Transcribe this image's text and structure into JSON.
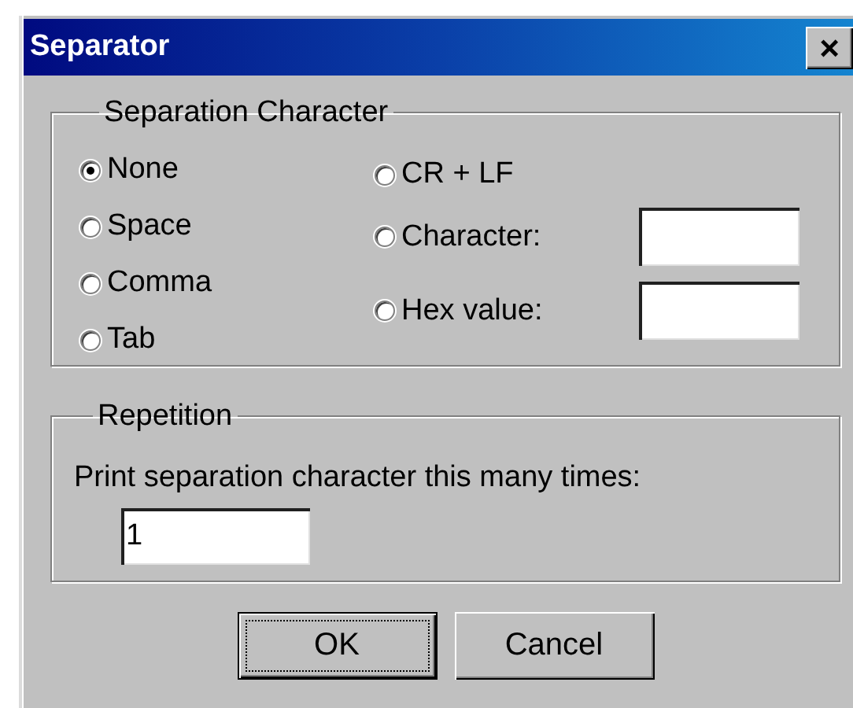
{
  "window": {
    "title": "Separator",
    "close_button": "×"
  },
  "separation_group": {
    "legend": "Separation Character",
    "columns": [
      [
        {
          "label": "None",
          "selected": true,
          "kind": "plain"
        },
        {
          "label": "Space",
          "selected": false,
          "kind": "plain"
        },
        {
          "label": "Comma",
          "selected": false,
          "kind": "plain"
        },
        {
          "label": "Tab",
          "selected": false,
          "kind": "plain"
        }
      ],
      [
        {
          "label": "CR + LF",
          "selected": false,
          "kind": "plain"
        },
        {
          "label": "Character:",
          "selected": false,
          "kind": "with_field"
        },
        {
          "label": "Hex value:",
          "selected": false,
          "kind": "with_field"
        }
      ]
    ]
  },
  "repetition_group": {
    "legend": "Repetition",
    "label": "Print separation character this many times:",
    "value": "1"
  },
  "buttons": [
    {
      "label": "OK",
      "focused": true
    },
    {
      "label": "Cancel",
      "focused": false
    }
  ]
}
